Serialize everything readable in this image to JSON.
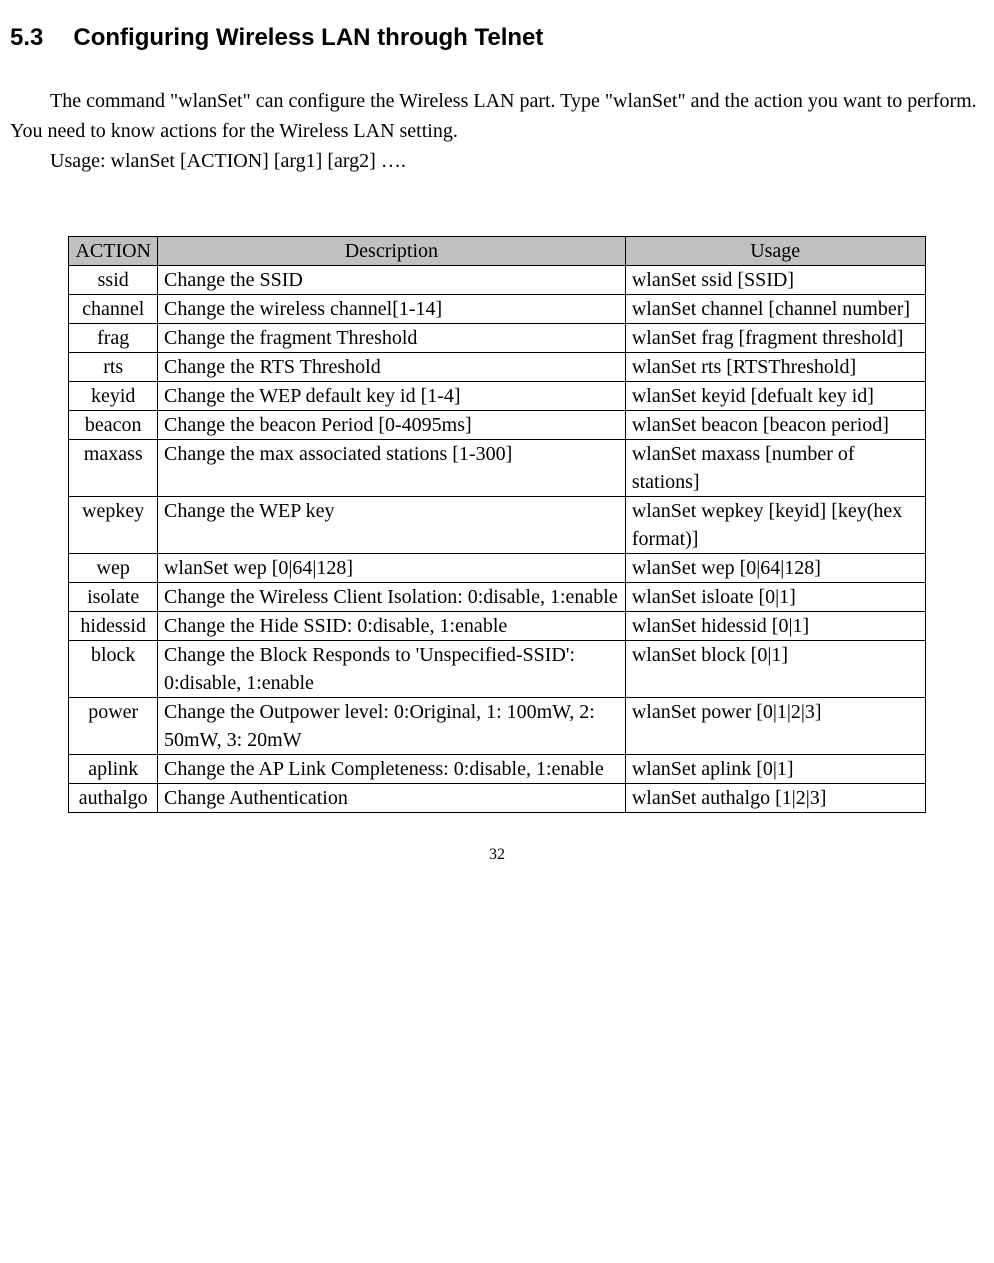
{
  "heading": {
    "number": "5.3",
    "title": "Configuring Wireless LAN through Telnet"
  },
  "paragraphs": {
    "p1": "The command \"wlanSet\" can configure the Wireless LAN part. Type \"wlanSet\" and the action you want to perform. You need to know actions for the Wireless LAN setting.",
    "p2": "Usage: wlanSet [ACTION] [arg1] [arg2] …."
  },
  "table": {
    "headers": {
      "action": "ACTION",
      "description": "Description",
      "usage": "Usage"
    },
    "rows": [
      {
        "action": "ssid",
        "description": "Change the SSID",
        "usage": "wlanSet ssid [SSID]"
      },
      {
        "action": "channel",
        "description": "Change the wireless channel[1-14]",
        "usage": "wlanSet channel [channel number]"
      },
      {
        "action": "frag",
        "description": "Change the fragment Threshold",
        "usage": "wlanSet frag [fragment threshold]"
      },
      {
        "action": "rts",
        "description": "Change the RTS Threshold",
        "usage": "wlanSet rts [RTSThreshold]"
      },
      {
        "action": "keyid",
        "description": "Change the WEP default key id [1-4]",
        "usage": "wlanSet keyid [defualt key id]"
      },
      {
        "action": "beacon",
        "description": "Change the beacon Period [0-4095ms]",
        "usage": "wlanSet beacon [beacon period]"
      },
      {
        "action": "maxass",
        "description": "Change the max associated stations [1-300]",
        "usage": "wlanSet maxass [number of stations]"
      },
      {
        "action": "wepkey",
        "description": "Change the WEP key",
        "usage": "wlanSet wepkey [keyid] [key(hex format)]"
      },
      {
        "action": "wep",
        "description": "wlanSet wep [0|64|128]",
        "usage": "wlanSet wep [0|64|128]"
      },
      {
        "action": "isolate",
        "description": "Change the Wireless Client Isolation: 0:disable, 1:enable",
        "usage": "wlanSet isloate [0|1]"
      },
      {
        "action": "hidessid",
        "description": "Change the Hide SSID: 0:disable, 1:enable",
        "usage": "wlanSet hidessid [0|1]"
      },
      {
        "action": "block",
        "description": "Change the Block Responds to 'Unspecified-SSID': 0:disable, 1:enable",
        "usage": "wlanSet block [0|1]"
      },
      {
        "action": "power",
        "description": "Change the Outpower level: 0:Original, 1: 100mW, 2: 50mW, 3: 20mW",
        "usage": "wlanSet power [0|1|2|3]"
      },
      {
        "action": "aplink",
        "description": "Change the AP Link Completeness: 0:disable, 1:enable",
        "usage": "wlanSet aplink [0|1]"
      },
      {
        "action": "authalgo",
        "description": "Change Authentication",
        "usage": "wlanSet authalgo [1|2|3]"
      }
    ]
  },
  "page_number": "32"
}
